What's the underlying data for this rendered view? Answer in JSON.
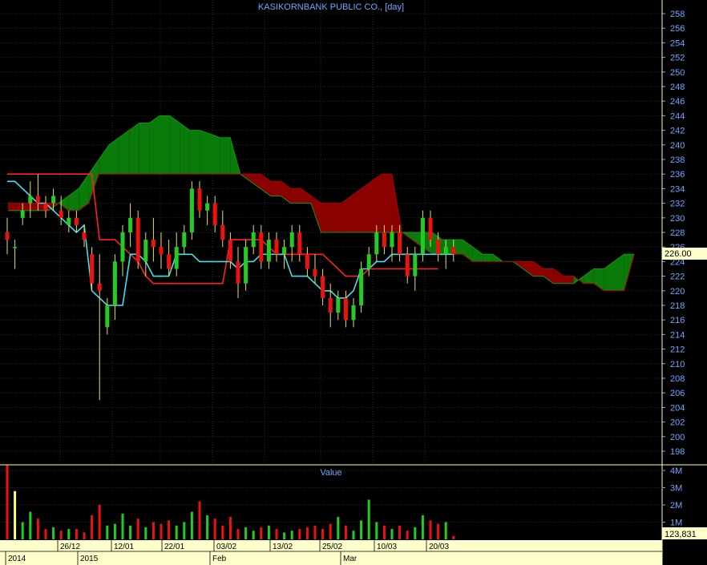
{
  "chart_data": [
    {
      "type": "candlestick",
      "title": "KASIKORNBANK PUBLIC CO., [day]",
      "ylim": [
        196,
        259
      ],
      "y_ticks": [
        198,
        200,
        202,
        204,
        206,
        208,
        210,
        212,
        214,
        216,
        218,
        220,
        222,
        224,
        226,
        228,
        230,
        232,
        234,
        236,
        238,
        240,
        242,
        244,
        246,
        248,
        250,
        252,
        254,
        256,
        258
      ],
      "last_price": "226.00",
      "grid": true,
      "x_labels": [
        "2014",
        "26/12",
        "2015",
        "12/01",
        "22/01",
        "Feb",
        "03/02",
        "13/02",
        "25/02",
        "Mar",
        "10/03",
        "20/03"
      ],
      "candles": [
        {
          "o": 228,
          "h": 230,
          "l": 225,
          "c": 227
        },
        {
          "o": 226,
          "h": 227,
          "l": 223,
          "c": 226
        },
        {
          "o": 230,
          "h": 232,
          "l": 229,
          "c": 231
        },
        {
          "o": 232,
          "h": 235,
          "l": 230,
          "c": 233
        },
        {
          "o": 233,
          "h": 236,
          "l": 231,
          "c": 232
        },
        {
          "o": 232,
          "h": 233,
          "l": 230,
          "c": 231
        },
        {
          "o": 232,
          "h": 234,
          "l": 231,
          "c": 233
        },
        {
          "o": 231,
          "h": 233,
          "l": 229,
          "c": 230
        },
        {
          "o": 229,
          "h": 231,
          "l": 228,
          "c": 230
        },
        {
          "o": 230,
          "h": 231,
          "l": 228,
          "c": 229
        },
        {
          "o": 228,
          "h": 229,
          "l": 226,
          "c": 227
        },
        {
          "o": 225,
          "h": 226,
          "l": 220,
          "c": 221
        },
        {
          "o": 221,
          "h": 225,
          "l": 205,
          "c": 220
        },
        {
          "o": 215,
          "h": 219,
          "l": 214,
          "c": 218
        },
        {
          "o": 218,
          "h": 225,
          "l": 216,
          "c": 224
        },
        {
          "o": 224,
          "h": 229,
          "l": 222,
          "c": 228
        },
        {
          "o": 228,
          "h": 232,
          "l": 226,
          "c": 230
        },
        {
          "o": 230,
          "h": 231,
          "l": 223,
          "c": 224
        },
        {
          "o": 224,
          "h": 228,
          "l": 222,
          "c": 227
        },
        {
          "o": 227,
          "h": 230,
          "l": 224,
          "c": 226
        },
        {
          "o": 226,
          "h": 228,
          "l": 223,
          "c": 225
        },
        {
          "o": 225,
          "h": 227,
          "l": 222,
          "c": 223
        },
        {
          "o": 223,
          "h": 228,
          "l": 222,
          "c": 226
        },
        {
          "o": 226,
          "h": 229,
          "l": 225,
          "c": 228
        },
        {
          "o": 228,
          "h": 235,
          "l": 227,
          "c": 234
        },
        {
          "o": 234,
          "h": 235,
          "l": 230,
          "c": 231
        },
        {
          "o": 231,
          "h": 233,
          "l": 229,
          "c": 232
        },
        {
          "o": 232,
          "h": 233,
          "l": 228,
          "c": 229
        },
        {
          "o": 229,
          "h": 231,
          "l": 226,
          "c": 227
        },
        {
          "o": 227,
          "h": 228,
          "l": 223,
          "c": 224
        },
        {
          "o": 224,
          "h": 226,
          "l": 219,
          "c": 221
        },
        {
          "o": 221,
          "h": 227,
          "l": 220,
          "c": 226
        },
        {
          "o": 226,
          "h": 229,
          "l": 225,
          "c": 228
        },
        {
          "o": 228,
          "h": 229,
          "l": 223,
          "c": 224
        },
        {
          "o": 224,
          "h": 228,
          "l": 223,
          "c": 227
        },
        {
          "o": 227,
          "h": 228,
          "l": 224,
          "c": 225
        },
        {
          "o": 225,
          "h": 227,
          "l": 223,
          "c": 226
        },
        {
          "o": 226,
          "h": 229,
          "l": 224,
          "c": 228
        },
        {
          "o": 228,
          "h": 229,
          "l": 224,
          "c": 225
        },
        {
          "o": 225,
          "h": 226,
          "l": 222,
          "c": 223
        },
        {
          "o": 223,
          "h": 225,
          "l": 221,
          "c": 222
        },
        {
          "o": 222,
          "h": 223,
          "l": 218,
          "c": 219
        },
        {
          "o": 219,
          "h": 221,
          "l": 215,
          "c": 217
        },
        {
          "o": 217,
          "h": 220,
          "l": 216,
          "c": 219
        },
        {
          "o": 219,
          "h": 220,
          "l": 215,
          "c": 216
        },
        {
          "o": 216,
          "h": 219,
          "l": 215,
          "c": 218
        },
        {
          "o": 218,
          "h": 224,
          "l": 217,
          "c": 223
        },
        {
          "o": 223,
          "h": 226,
          "l": 222,
          "c": 225
        },
        {
          "o": 225,
          "h": 229,
          "l": 224,
          "c": 228
        },
        {
          "o": 228,
          "h": 229,
          "l": 225,
          "c": 226
        },
        {
          "o": 226,
          "h": 229,
          "l": 224,
          "c": 228
        },
        {
          "o": 228,
          "h": 229,
          "l": 224,
          "c": 225
        },
        {
          "o": 225,
          "h": 226,
          "l": 221,
          "c": 222
        },
        {
          "o": 222,
          "h": 226,
          "l": 220,
          "c": 225
        },
        {
          "o": 225,
          "h": 231,
          "l": 224,
          "c": 230
        },
        {
          "o": 230,
          "h": 231,
          "l": 226,
          "c": 227
        },
        {
          "o": 227,
          "h": 228,
          "l": 224,
          "c": 225
        },
        {
          "o": 225,
          "h": 227,
          "l": 223,
          "c": 226
        },
        {
          "o": 226,
          "h": 227,
          "l": 224,
          "c": 225
        }
      ],
      "tenkan_sen": [
        235,
        235,
        234,
        233,
        232,
        232,
        231,
        230,
        229,
        228,
        229,
        220,
        219,
        218,
        218,
        218,
        225,
        225,
        224,
        222,
        222,
        222,
        225,
        225,
        225,
        224,
        224,
        224,
        224,
        224,
        223,
        224,
        224,
        225,
        225,
        225,
        225,
        222,
        222,
        222,
        221,
        220,
        220,
        219,
        219,
        220,
        223,
        223,
        224,
        224,
        225,
        225,
        225,
        225,
        225,
        225,
        225,
        225,
        225
      ],
      "kijun_sen": [
        236,
        236,
        236,
        236,
        236,
        236,
        236,
        236,
        236,
        236,
        236,
        236,
        227,
        227,
        227,
        226,
        225,
        224,
        222,
        221,
        221,
        221,
        221,
        221,
        221,
        221,
        221,
        221,
        221,
        227,
        227,
        227,
        227,
        227,
        226,
        225,
        225,
        225,
        225,
        225,
        225,
        225,
        224,
        223,
        222,
        222,
        222,
        223,
        223,
        223,
        223,
        223,
        223,
        223,
        223,
        223,
        223
      ],
      "volume": {
        "label": "Value",
        "last": "123,831",
        "y_ticks": [
          "1M",
          "2M",
          "3M",
          "4M"
        ],
        "ylim": [
          0,
          4800000
        ],
        "values": [
          4.3,
          2.8,
          1.0,
          1.6,
          1.2,
          0.6,
          0.7,
          0.5,
          0.6,
          0.6,
          0.4,
          1.4,
          2.0,
          0.8,
          0.9,
          1.5,
          0.8,
          1.2,
          0.7,
          1.0,
          0.9,
          1.1,
          0.8,
          1.0,
          1.6,
          2.2,
          1.4,
          1.2,
          0.8,
          1.3,
          0.6,
          0.7,
          0.5,
          0.7,
          0.8,
          0.6,
          0.4,
          0.5,
          0.6,
          0.7,
          0.8,
          0.6,
          0.9,
          1.3,
          0.8,
          0.5,
          1.1,
          2.3,
          1.0,
          0.8,
          0.6,
          0.8,
          0.5,
          0.7,
          1.4,
          1.1,
          0.9,
          1.0,
          0.2
        ]
      }
    }
  ]
}
